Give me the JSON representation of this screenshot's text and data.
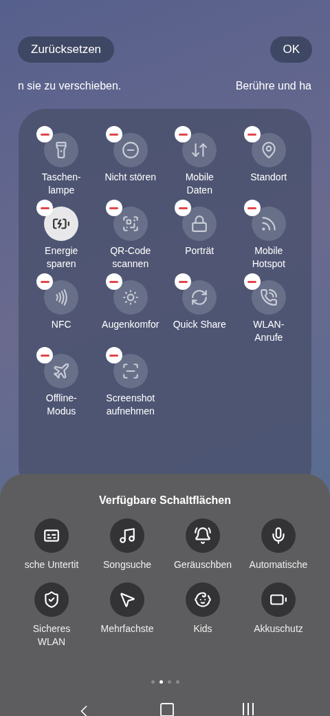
{
  "top_bar": {
    "reset_button": "Zurücksetzen",
    "ok_button": "OK"
  },
  "hints": [
    "n sie zu verschieben.",
    "Berühre und ha"
  ],
  "active_tiles": [
    {
      "label": "Taschen-\nlampe",
      "on": false
    },
    {
      "label": "Nicht stören",
      "on": false
    },
    {
      "label": "Mobile\nDaten",
      "on": false
    },
    {
      "label": "Standort",
      "on": false
    },
    {
      "label": "Energie\nsparen",
      "on": true
    },
    {
      "label": "QR-Code\nscannen",
      "on": false
    },
    {
      "label": "Porträt",
      "on": false
    },
    {
      "label": "Mobile\nHotspot",
      "on": false
    },
    {
      "label": "NFC",
      "on": false
    },
    {
      "label": "Augenkomfor",
      "on": false
    },
    {
      "label": "Quick Share",
      "on": false
    },
    {
      "label": "WLAN-\nAnrufe",
      "on": false
    },
    {
      "label": "Offline-\nModus",
      "on": false
    },
    {
      "label": "Screenshot\naufnehmen",
      "on": false
    }
  ],
  "available": {
    "title": "Verfügbare Schaltflächen",
    "buttons": [
      "sche Untertit",
      "Songsuche",
      "Geräuschben",
      "Automatische",
      "Sicheres\nWLAN",
      "Mehrfachste",
      "Kids",
      "Akkuschutz"
    ],
    "page_dots": [
      {
        "selected": false
      },
      {
        "selected": true
      },
      {
        "selected": false
      },
      {
        "selected": false
      }
    ]
  }
}
